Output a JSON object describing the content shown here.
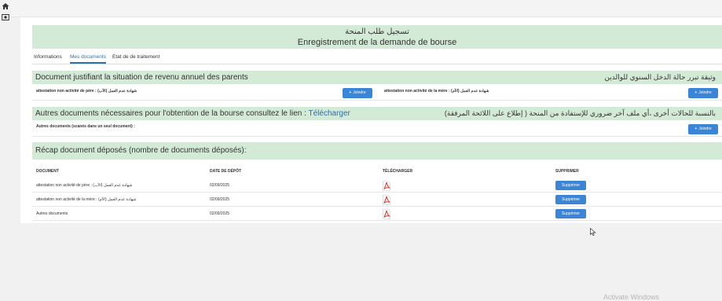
{
  "header": {
    "title_ar": "تسجيل طلب المنحة",
    "title_fr": "Enregistrement de la demande de bourse"
  },
  "tabs": [
    "Informations",
    "Mes documents",
    "Etat de de traitement"
  ],
  "section1": {
    "title_fr": "Document justifiant la situation de revenu annuel des parents",
    "title_ar": "وثيقة تبرر حالة الدخل السنوي للوالدين",
    "left_label": "attestation non activité de père : شهادة عدم العمل (الأب)",
    "right_label": "attestation non activité de la mère : شهادة عدم العمل (الأم)",
    "join_label": "Joindre"
  },
  "section2": {
    "title_fr": "Autres documents nécessaires pour l'obtention de la bourse consultez le lien : ",
    "link_label": "Télécharger",
    "title_ar": "بالنسبة للحالات أخرى ،أي ملف آخر ضروري للإستفادة من المنحة ( إطلاع على اللائحة المرفقة)",
    "label": "Autres documents (scanés dans un seul document) :",
    "join_label": "Joindre"
  },
  "section3": {
    "title": "Récap document déposés (nombre de documents déposés):"
  },
  "table": {
    "headers": [
      "DOCUMENT",
      "DATE DE DÉPÔT",
      "TÉLÉCHARGER",
      "SUPPRIMER"
    ],
    "rows": [
      {
        "document": "attestation non activité de père : شهادة عدم العمل (الأب)",
        "date": "02/09/2025",
        "action": "Supprimer"
      },
      {
        "document": "attestation non activité de la mère : شهادة عدم العمل (الأم)",
        "date": "02/09/2025",
        "action": "Supprimer"
      },
      {
        "document": "Autres documents",
        "date": "02/09/2025",
        "action": "Supprimer"
      }
    ]
  },
  "watermark": "Activate Windows",
  "icons": [
    "home-icon",
    "eye-icon",
    "plus-icon",
    "pdf-icon",
    "cursor-icon"
  ],
  "colors": {
    "section_bg": "#d3ebd6",
    "primary": "#3a85d6",
    "pdf_red": "#d9332b",
    "link": "#2c6fb0"
  }
}
